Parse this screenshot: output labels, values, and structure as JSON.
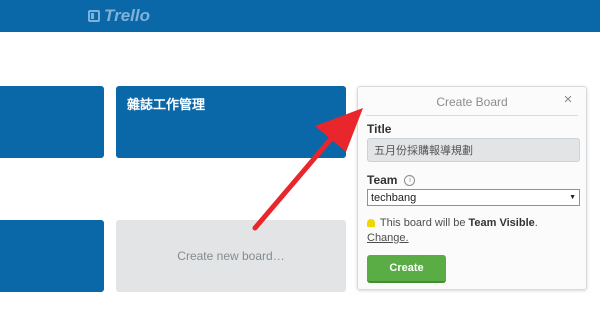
{
  "app": {
    "logo_text": "Trello",
    "brand_color": "#0a67a8"
  },
  "boards": {
    "board_title": "雜誌工作管理",
    "create_new_label": "Create new board…"
  },
  "popover": {
    "header_title": "Create Board",
    "close_symbol": "×",
    "title_label": "Title",
    "title_value": "五月份採購報導規劃",
    "team_label": "Team",
    "info_symbol": "i",
    "team_value": "techbang",
    "visibility_prefix": "This board will be",
    "visibility_strong": "Team Visible",
    "visibility_suffix": ".",
    "change_link": "Change.",
    "create_button": "Create",
    "create_button_color": "#5aac44"
  },
  "annotation": {
    "arrow_color": "#e8262b",
    "icon": "red-arrow-annotation"
  }
}
